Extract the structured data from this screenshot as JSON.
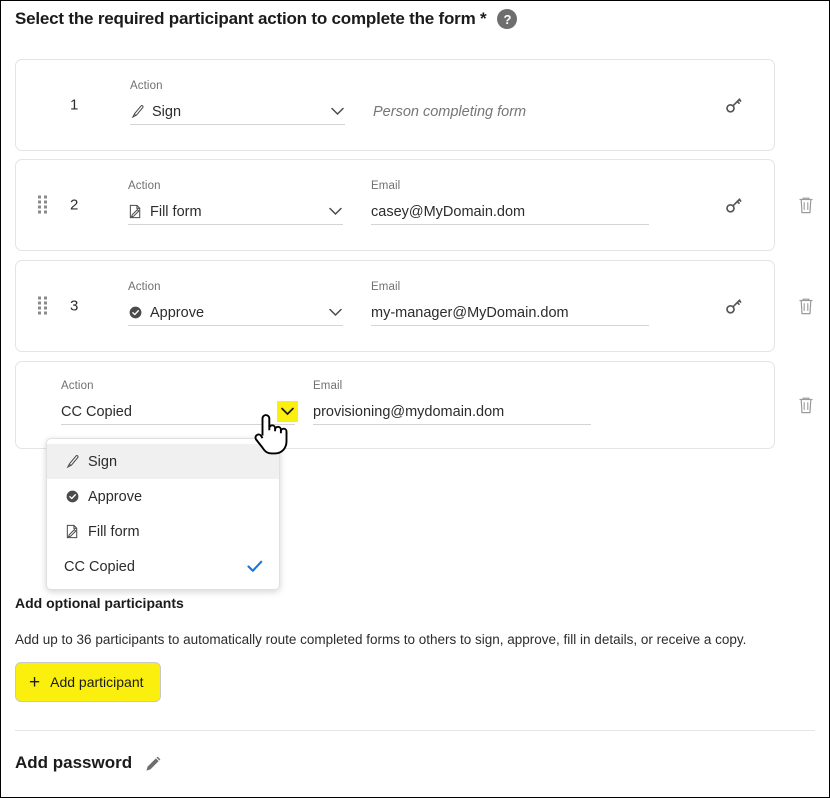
{
  "header": {
    "title": "Select the required participant action to complete the form *",
    "help_icon": "help-circle-icon",
    "help_glyph": "?"
  },
  "labels": {
    "action": "Action",
    "email": "Email"
  },
  "participants": [
    {
      "number": "1",
      "action": "Sign",
      "action_icon": "sign-pen-icon",
      "email": "",
      "email_placeholder": "Person completing form",
      "has_drag_handle": false,
      "has_delete": false,
      "has_key": true,
      "email_label_visible": false,
      "chevron_highlighted": false
    },
    {
      "number": "2",
      "action": "Fill form",
      "action_icon": "fill-form-icon",
      "email": "casey@MyDomain.dom",
      "email_placeholder": "",
      "has_drag_handle": true,
      "has_delete": true,
      "has_key": true,
      "email_label_visible": true,
      "chevron_highlighted": false
    },
    {
      "number": "3",
      "action": "Approve",
      "action_icon": "approve-check-icon",
      "email": "my-manager@MyDomain.dom",
      "email_placeholder": "",
      "has_drag_handle": true,
      "has_delete": true,
      "has_key": true,
      "email_label_visible": true,
      "chevron_highlighted": false
    },
    {
      "number": "",
      "action": "CC Copied",
      "action_icon": "none",
      "email": "provisioning@mydomain.dom",
      "email_placeholder": "",
      "has_drag_handle": false,
      "has_delete": true,
      "has_key": false,
      "email_label_visible": true,
      "chevron_highlighted": true
    }
  ],
  "dropdown": {
    "open": true,
    "items": [
      {
        "label": "Sign",
        "icon": "sign-pen-icon",
        "selected": false,
        "hovered": true
      },
      {
        "label": "Approve",
        "icon": "approve-check-icon",
        "selected": false,
        "hovered": false
      },
      {
        "label": "Fill form",
        "icon": "fill-form-icon",
        "selected": false,
        "hovered": false
      },
      {
        "label": "CC Copied",
        "icon": "none",
        "selected": true,
        "hovered": false
      }
    ],
    "check_icon": "checkmark-icon"
  },
  "optional_section": {
    "heading": "Add optional participants",
    "description": "Add up to 36 participants to automatically route completed forms to others to sign, approve, fill in details, or receive a copy.",
    "add_button_label": "Add participant",
    "add_button_icon": "plus-icon"
  },
  "password_section": {
    "heading": "Add password",
    "edit_icon": "pencil-icon"
  },
  "icons": {
    "key": "key-icon",
    "trash": "trash-icon",
    "drag": "drag-handle-icon",
    "chevron": "chevron-down-icon",
    "cursor": "hand-pointer-cursor"
  },
  "colors": {
    "highlight_yellow": "#fbf00d",
    "accent_blue": "#1473e6",
    "text_primary": "#2c2c2c",
    "text_muted": "#707070",
    "card_border": "#e4e4e4"
  }
}
